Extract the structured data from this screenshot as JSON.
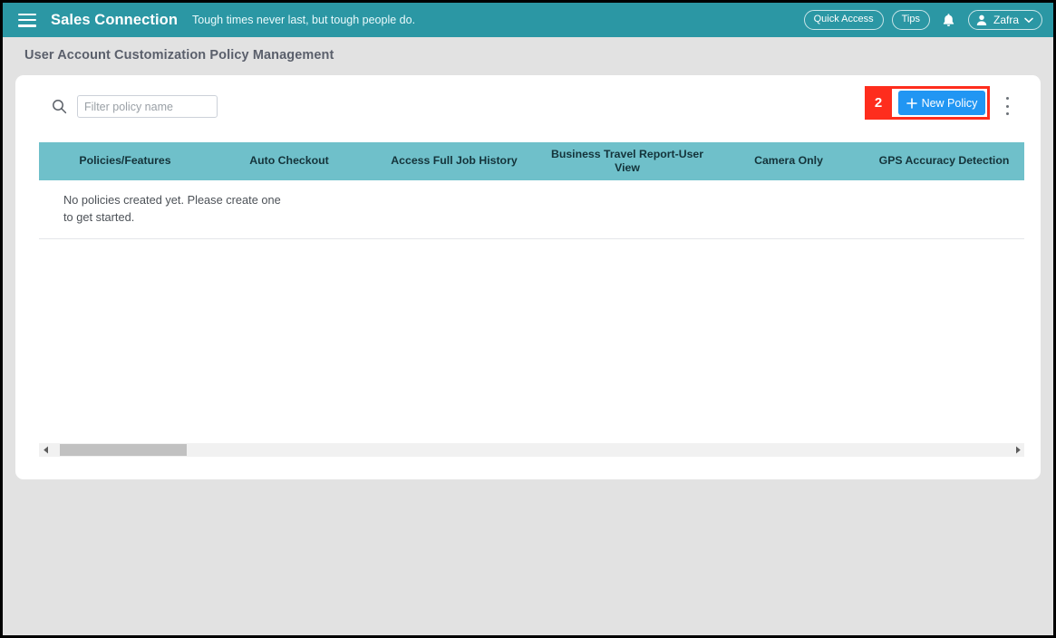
{
  "appbar": {
    "menu_icon": "hamburger-menu-icon",
    "brand": "Sales Connection",
    "tagline": "Tough times never last, but tough people do.",
    "quick_access_label": "Quick Access",
    "tips_label": "Tips",
    "notification_icon": "bell-icon",
    "user_icon": "user-avatar-icon",
    "user_name": "Zafra",
    "user_caret_icon": "chevron-down-icon",
    "bg_color": "#2b97a4"
  },
  "page": {
    "title": "User Account Customization Policy Management",
    "background": "#e2e2e2"
  },
  "toolbar": {
    "search_icon": "search-icon",
    "search_value": "",
    "search_placeholder": "Filter policy name",
    "new_policy_label": "New Policy",
    "new_policy_icon": "plus-icon",
    "new_policy_color": "#2196f3",
    "kebab_icon": "more-vertical-icon"
  },
  "annotation": {
    "step_number": "2",
    "color": "#fe2d1d"
  },
  "table": {
    "header_color": "#6fc0ca",
    "columns": [
      "Policies/Features",
      "Auto Checkout",
      "Access Full Job History",
      "Business Travel Report-User View",
      "Camera Only",
      "GPS Accuracy Detection"
    ],
    "empty_message_line1": "No policies created yet. Please create one",
    "empty_message_line2": "to get started."
  },
  "scrollbar": {
    "left_arrow_icon": "chevron-left-icon",
    "right_arrow_icon": "chevron-right-icon"
  }
}
